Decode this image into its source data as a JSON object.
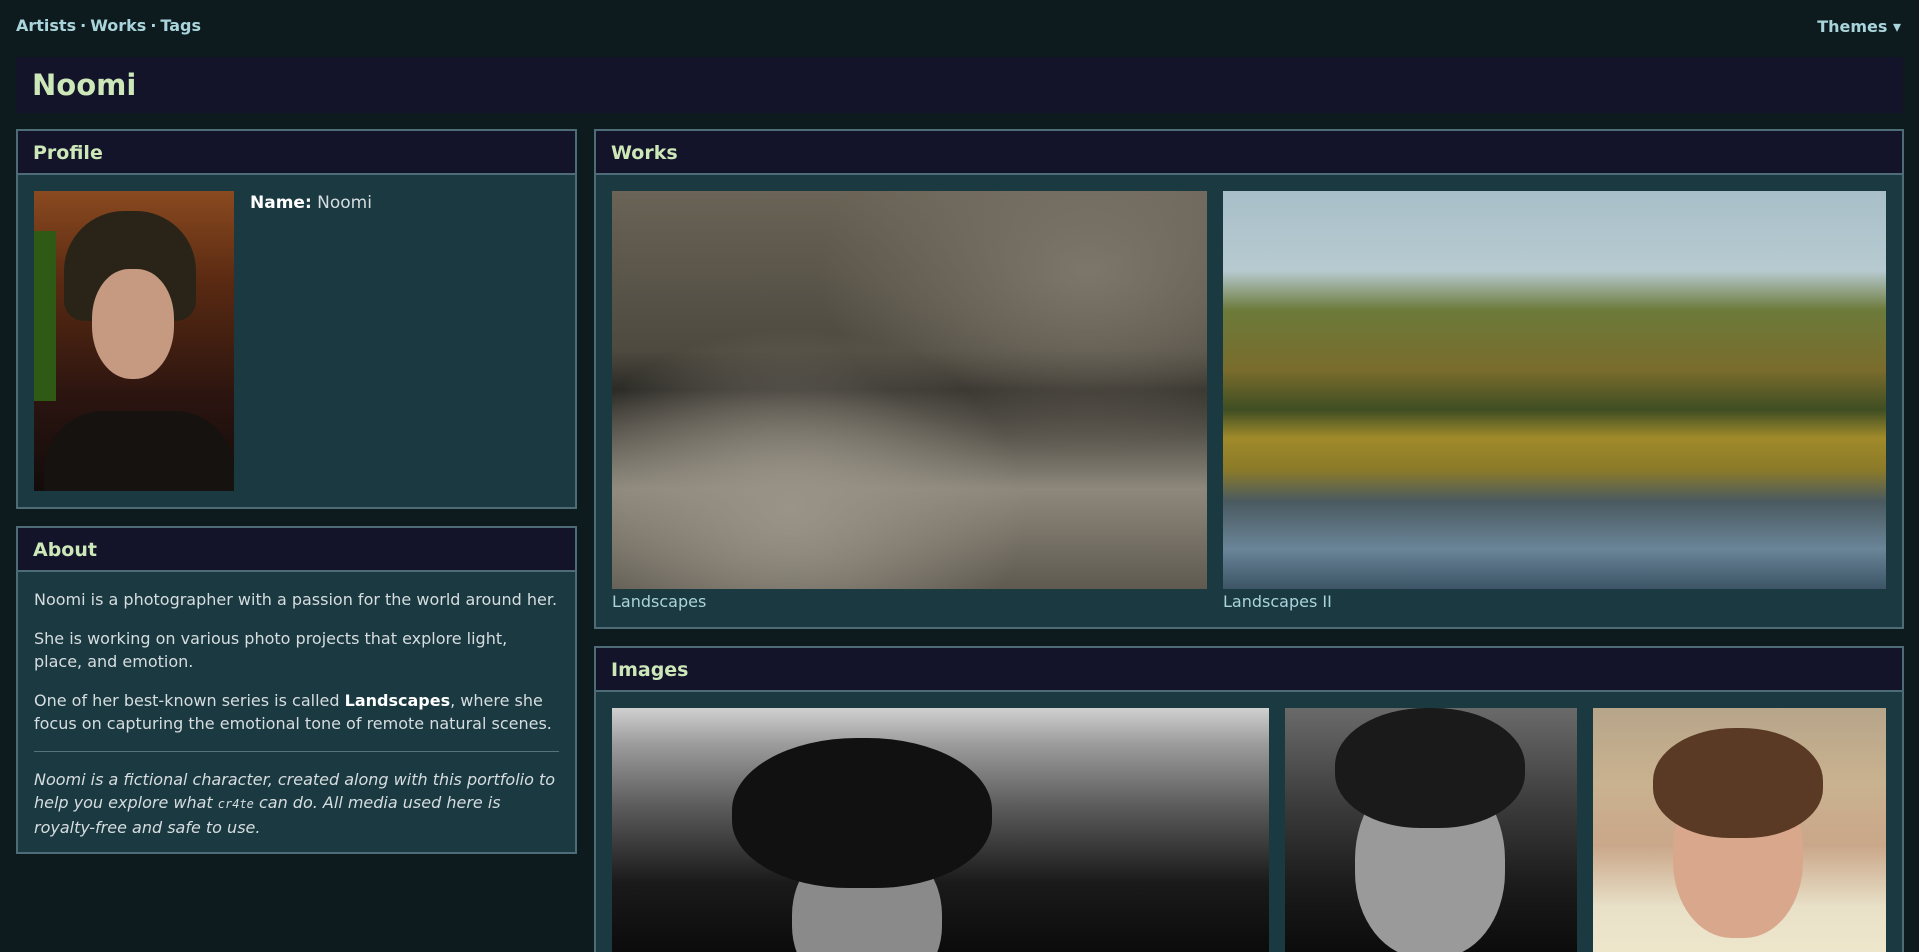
{
  "nav": {
    "items": [
      "Artists",
      "Works",
      "Tags"
    ],
    "separator": "·",
    "themes_label": "Themes ▾"
  },
  "header": {
    "title": "Noomi"
  },
  "profile": {
    "heading": "Profile",
    "name_label": "Name:",
    "name_value": "Noomi"
  },
  "about": {
    "heading": "About",
    "p1": "Noomi is a photographer with a passion for the world around her.",
    "p2": "She is working on various photo projects that explore light, place, and emotion.",
    "p3_before": "One of her best-known series is called ",
    "p3_bold": "Landscapes",
    "p3_after": ", where she focus on capturing the emotional tone of remote natural scenes.",
    "note_before": "Noomi is a fictional character, created along with this portfolio to help you explore what ",
    "note_code": "cr4te",
    "note_after": " can do. All media used here is royalty-free and safe to use."
  },
  "works": {
    "heading": "Works",
    "items": [
      {
        "caption": "Landscapes"
      },
      {
        "caption": "Landscapes II"
      }
    ]
  },
  "images": {
    "heading": "Images"
  },
  "colors": {
    "background": "#0d1b1f",
    "panel": "#1b3940",
    "panel_header": "#13132a",
    "link": "#a9d4db",
    "heading": "#cde8b8"
  }
}
